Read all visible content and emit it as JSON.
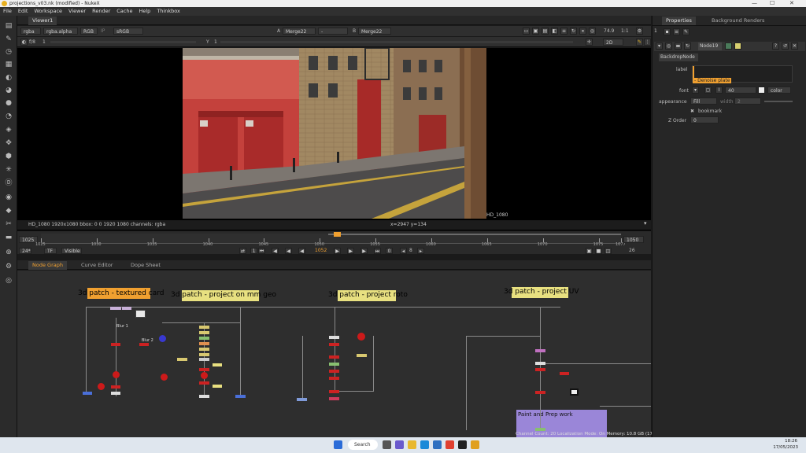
{
  "window": {
    "title": "projections_v03.nk (modified) - NukeX",
    "min": "—",
    "max": "☐",
    "close": "✕"
  },
  "menu": [
    "File",
    "Edit",
    "Workspace",
    "Viewer",
    "Render",
    "Cache",
    "Help",
    "Thinkbox"
  ],
  "toolbar_icons": [
    "tab-icon",
    "paint-icon",
    "clock-icon",
    "layers-icon",
    "color-icon",
    "circle-icon",
    "filter-icon",
    "keyer-icon",
    "merge-icon",
    "transform-icon",
    "3d-icon",
    "particle-icon",
    "deep-icon",
    "views-icon",
    "metadata-icon",
    "toolsets-icon",
    "other-icon",
    "cara-icon",
    "gear-icon",
    "nuke-icon"
  ],
  "viewer": {
    "tab": "Viewer1",
    "channels": "rgba",
    "alpha": "rgba.alpha",
    "display": "RGB",
    "ip": "IP",
    "lut": "sRGB",
    "a_label": "A",
    "a_input": "Merge22",
    "dash": "-",
    "b_label": "B",
    "b_input": "Merge22",
    "zoom": "74.9",
    "ratio": "1:1",
    "fstop": "f/8",
    "frame_inc": "1",
    "y_label": "Y",
    "y_val": "1",
    "mode": "2D",
    "format": "HD_1080",
    "info": "HD_1080 1920x1080  bbox: 0 0 1920 1080 channels: rgba",
    "coords": "x=2947 y=134",
    "format_corner": "HD_1080"
  },
  "timeline": {
    "start": "1025",
    "end": "1050",
    "ticks": [
      "1025",
      "1030",
      "1035",
      "1040",
      "1045",
      "1050",
      "1055",
      "1060",
      "1065",
      "1070",
      "1075",
      "1077"
    ],
    "current": "1052",
    "fps": "24*",
    "tf": "TF",
    "visible": "Visible",
    "step": "8",
    "right_val": "26",
    "in_frame": "1",
    "out_frame": "0"
  },
  "bottom_tabs": [
    "Node Graph",
    "Curve Editor",
    "Dope Sheet"
  ],
  "backdrops": [
    {
      "label": "3d patch - textured card"
    },
    {
      "label": "3d patch - project on mm geo"
    },
    {
      "label": "3d patch - project roto"
    },
    {
      "label": "3d patch - project UV"
    },
    {
      "label": "Paint and Prep work"
    }
  ],
  "node_labels": {
    "n1": "Blur 1",
    "n2": "Blur 2"
  },
  "status_line": "Channel Count: 20  Localization Mode: On  Memory: 10.8 GB (17.0%)  CPU: 1.6%  Disk: 0.2 MB/s  Network: 0.1 MB/s",
  "properties": {
    "tab1": "Properties",
    "tab2": "Background Renders",
    "node_name": "Node19",
    "node_class": "BackdropNode",
    "label_label": "label",
    "label_value": "- Denoise plate",
    "font_label": "font",
    "font_size": "40",
    "color_label": "color",
    "appearance_label": "appearance",
    "appearance_value": "Fill",
    "width_label": "width",
    "width_value": "2",
    "bookmark_label": "bookmark",
    "zorder_label": "Z Order",
    "zorder_value": "0",
    "counter": "1"
  },
  "taskbar": {
    "search": "Search",
    "time": "18:26",
    "date": "17/05/2023"
  },
  "colors": {
    "orange": "#f0a030",
    "yellow": "#e8e080",
    "purple": "#9a86d8"
  }
}
